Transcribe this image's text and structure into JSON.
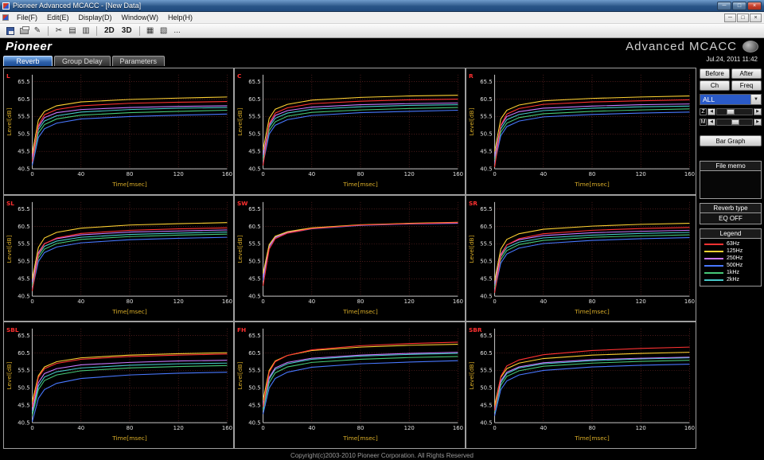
{
  "window": {
    "title": "Pioneer Advanced MCACC - [New Data]",
    "minimize": "─",
    "maximize": "□",
    "close": "×"
  },
  "menu": {
    "items": [
      "File(F)",
      "Edit(E)",
      "Display(D)",
      "Window(W)",
      "Help(H)"
    ]
  },
  "toolbar": {
    "btn_2d": "2D",
    "btn_3d": "3D",
    "overflow": "..."
  },
  "header": {
    "logo": "Pioneer",
    "app_title": "Advanced MCACC",
    "datetime": "Jul.24, 2011 11:42"
  },
  "tabs": [
    {
      "label": "Reverb",
      "active": true
    },
    {
      "label": "Group Delay",
      "active": false
    },
    {
      "label": "Parameters",
      "active": false
    }
  ],
  "sidebar": {
    "before": "Before",
    "after": "After",
    "ch": "Ch",
    "freq": "Freq",
    "channel_select": "ALL",
    "sliders": [
      {
        "label": "Z"
      },
      {
        "label": "M"
      }
    ],
    "bar_graph": "Bar Graph",
    "file_memo_title": "File memo",
    "file_memo_value": "",
    "reverb_type_title": "Reverb type",
    "reverb_type_value": "EQ OFF",
    "legend_title": "Legend"
  },
  "footer": {
    "copyright": "Copyright(c)2003-2010 Pioneer Corporation. All Rights Reserved"
  },
  "chart_data": {
    "type": "line",
    "xlabel": "Time[msec]",
    "ylabel": "Level[dB]",
    "x": [
      0,
      5,
      10,
      20,
      40,
      80,
      120,
      160
    ],
    "xticks": [
      0,
      40,
      80,
      120,
      160
    ],
    "yticks": [
      40.5,
      45.5,
      50.5,
      55.5,
      60.5,
      65.5
    ],
    "xlim": [
      0,
      160
    ],
    "ylim": [
      40.5,
      67.5
    ],
    "legend_position": "sidebar",
    "grid": true,
    "series": [
      {
        "name": "63Hz",
        "color": "#ff3232"
      },
      {
        "name": "125Hz",
        "color": "#ffd232"
      },
      {
        "name": "250Hz",
        "color": "#c878ff"
      },
      {
        "name": "500Hz",
        "color": "#4878ff"
      },
      {
        "name": "1kHz",
        "color": "#46c878"
      },
      {
        "name": "2kHz",
        "color": "#46c8c8"
      }
    ],
    "charts": [
      {
        "channel": "L",
        "values": [
          [
            42.5,
            53,
            56,
            57.5,
            58.6,
            59.3,
            59.6,
            59.8
          ],
          [
            45,
            54.5,
            57,
            58.6,
            59.7,
            60.4,
            60.8,
            61.1
          ],
          [
            44,
            52.5,
            55.2,
            56.6,
            57.5,
            58.1,
            58.4,
            58.6
          ],
          [
            41.5,
            49.5,
            52,
            53.6,
            54.8,
            55.5,
            55.9,
            56.2
          ],
          [
            42.5,
            50.8,
            53.2,
            54.8,
            55.9,
            56.6,
            57,
            57.3
          ],
          [
            43.5,
            51.8,
            54.2,
            55.7,
            56.8,
            57.5,
            57.9,
            58.1
          ]
        ]
      },
      {
        "channel": "C",
        "values": [
          [
            41.5,
            53.5,
            56.5,
            58,
            59.2,
            59.9,
            60.3,
            60.5
          ],
          [
            46,
            55,
            57.6,
            59,
            60.2,
            61,
            61.4,
            61.6
          ],
          [
            44.5,
            53,
            55.8,
            57.2,
            58.2,
            58.9,
            59.2,
            59.4
          ],
          [
            42,
            50.5,
            53,
            54.6,
            55.8,
            56.6,
            57,
            57.3
          ],
          [
            43,
            51.5,
            54,
            55.6,
            56.7,
            57.4,
            57.8,
            58.1
          ],
          [
            44,
            52.5,
            55,
            56.5,
            57.6,
            58.3,
            58.7,
            58.9
          ]
        ]
      },
      {
        "channel": "R",
        "values": [
          [
            41,
            53,
            56.2,
            57.8,
            59,
            59.7,
            60,
            60.3
          ],
          [
            45.5,
            54.8,
            57.3,
            58.8,
            60,
            60.7,
            61.1,
            61.4
          ],
          [
            44,
            52.8,
            55.5,
            56.9,
            57.9,
            58.5,
            58.9,
            59.1
          ],
          [
            42,
            50,
            52.6,
            54.2,
            55.4,
            56.1,
            56.5,
            56.8
          ],
          [
            43,
            51,
            53.6,
            55.2,
            56.3,
            57,
            57.4,
            57.7
          ],
          [
            43.8,
            52,
            54.6,
            56.1,
            57.2,
            57.9,
            58.3,
            58.5
          ]
        ]
      },
      {
        "channel": "SL",
        "values": [
          [
            42,
            52.5,
            55.5,
            57.2,
            58.5,
            59.4,
            59.8,
            60.1
          ],
          [
            45.5,
            54.5,
            57.2,
            58.8,
            60,
            60.9,
            61.3,
            61.6
          ],
          [
            44.5,
            53,
            55.6,
            57,
            58.1,
            58.9,
            59.2,
            59.5
          ],
          [
            42.5,
            50.5,
            53,
            54.6,
            55.8,
            56.7,
            57.1,
            57.4
          ],
          [
            43.5,
            51.5,
            54,
            55.6,
            56.8,
            57.6,
            58,
            58.3
          ],
          [
            44.2,
            52.3,
            54.8,
            56.3,
            57.4,
            58.2,
            58.6,
            58.9
          ]
        ]
      },
      {
        "channel": "SW",
        "values": [
          [
            43.5,
            54,
            57,
            58.6,
            59.9,
            60.9,
            61.3,
            61.6
          ],
          [
            47,
            55.3,
            57.7,
            59,
            60.1,
            61,
            61.4,
            61.7
          ],
          [
            46,
            54.8,
            57.4,
            58.8,
            60,
            60.9,
            61.3,
            61.5
          ],
          [
            45,
            54.2,
            57.1,
            58.6,
            59.8,
            60.8,
            61.2,
            61.4
          ],
          [
            46.3,
            55,
            57.5,
            58.8,
            60,
            60.9,
            61.3,
            61.5
          ],
          [
            46.8,
            55.2,
            57.6,
            58.9,
            60,
            60.9,
            61.3,
            61.6
          ]
        ]
      },
      {
        "channel": "SR",
        "values": [
          [
            41.5,
            52,
            55.2,
            57,
            58.4,
            59.4,
            59.9,
            60.2
          ],
          [
            45,
            54,
            56.8,
            58.4,
            59.7,
            60.6,
            61.1,
            61.4
          ],
          [
            44,
            52.5,
            55.2,
            56.7,
            57.9,
            58.7,
            59.1,
            59.4
          ],
          [
            42,
            50,
            52.6,
            54.3,
            55.6,
            56.5,
            57,
            57.3
          ],
          [
            43,
            51,
            53.6,
            55.3,
            56.5,
            57.4,
            57.8,
            58.1
          ],
          [
            43.8,
            51.8,
            54.4,
            56,
            57.2,
            58,
            58.5,
            58.8
          ]
        ]
      },
      {
        "channel": "SBL",
        "values": [
          [
            45,
            53.5,
            56,
            57.5,
            58.7,
            59.5,
            59.9,
            60.2
          ],
          [
            46.5,
            54,
            56.5,
            58,
            59.1,
            59.9,
            60.3,
            60.6
          ],
          [
            44,
            52,
            54.6,
            56,
            57.1,
            57.8,
            58.2,
            58.4
          ],
          [
            40.8,
            47.5,
            50,
            51.8,
            53.2,
            54.2,
            54.7,
            55
          ],
          [
            42.5,
            50,
            52.6,
            54.2,
            55.4,
            56.2,
            56.6,
            56.9
          ],
          [
            43.5,
            51,
            53.6,
            55.1,
            56.2,
            57,
            57.4,
            57.6
          ]
        ]
      },
      {
        "channel": "FH",
        "values": [
          [
            45,
            55,
            58,
            59.8,
            61.4,
            62.6,
            63.2,
            63.6
          ],
          [
            47,
            55.5,
            58.2,
            59.8,
            61.2,
            62.2,
            62.7,
            63
          ],
          [
            45.5,
            53.5,
            56.2,
            57.8,
            59,
            59.9,
            60.4,
            60.7
          ],
          [
            43,
            50.5,
            53.2,
            55,
            56.4,
            57.4,
            57.9,
            58.3
          ],
          [
            44,
            52,
            54.8,
            56.5,
            57.8,
            58.7,
            59.2,
            59.5
          ],
          [
            44.8,
            53,
            55.8,
            57.4,
            58.7,
            59.6,
            60.1,
            60.4
          ]
        ]
      },
      {
        "channel": "SBR",
        "values": [
          [
            44,
            53.8,
            56.8,
            58.5,
            60,
            61.2,
            61.8,
            62.2
          ],
          [
            45.5,
            53.5,
            56,
            57.6,
            58.9,
            59.9,
            60.4,
            60.7
          ],
          [
            44.5,
            52.5,
            55,
            56.5,
            57.7,
            58.6,
            59,
            59.3
          ],
          [
            42.5,
            50,
            52.5,
            54.2,
            55.5,
            56.5,
            57,
            57.3
          ],
          [
            43.5,
            51.2,
            53.8,
            55.4,
            56.7,
            57.6,
            58.1,
            58.4
          ],
          [
            44,
            52,
            54.6,
            56.2,
            57.4,
            58.3,
            58.8,
            59.1
          ]
        ]
      }
    ]
  }
}
